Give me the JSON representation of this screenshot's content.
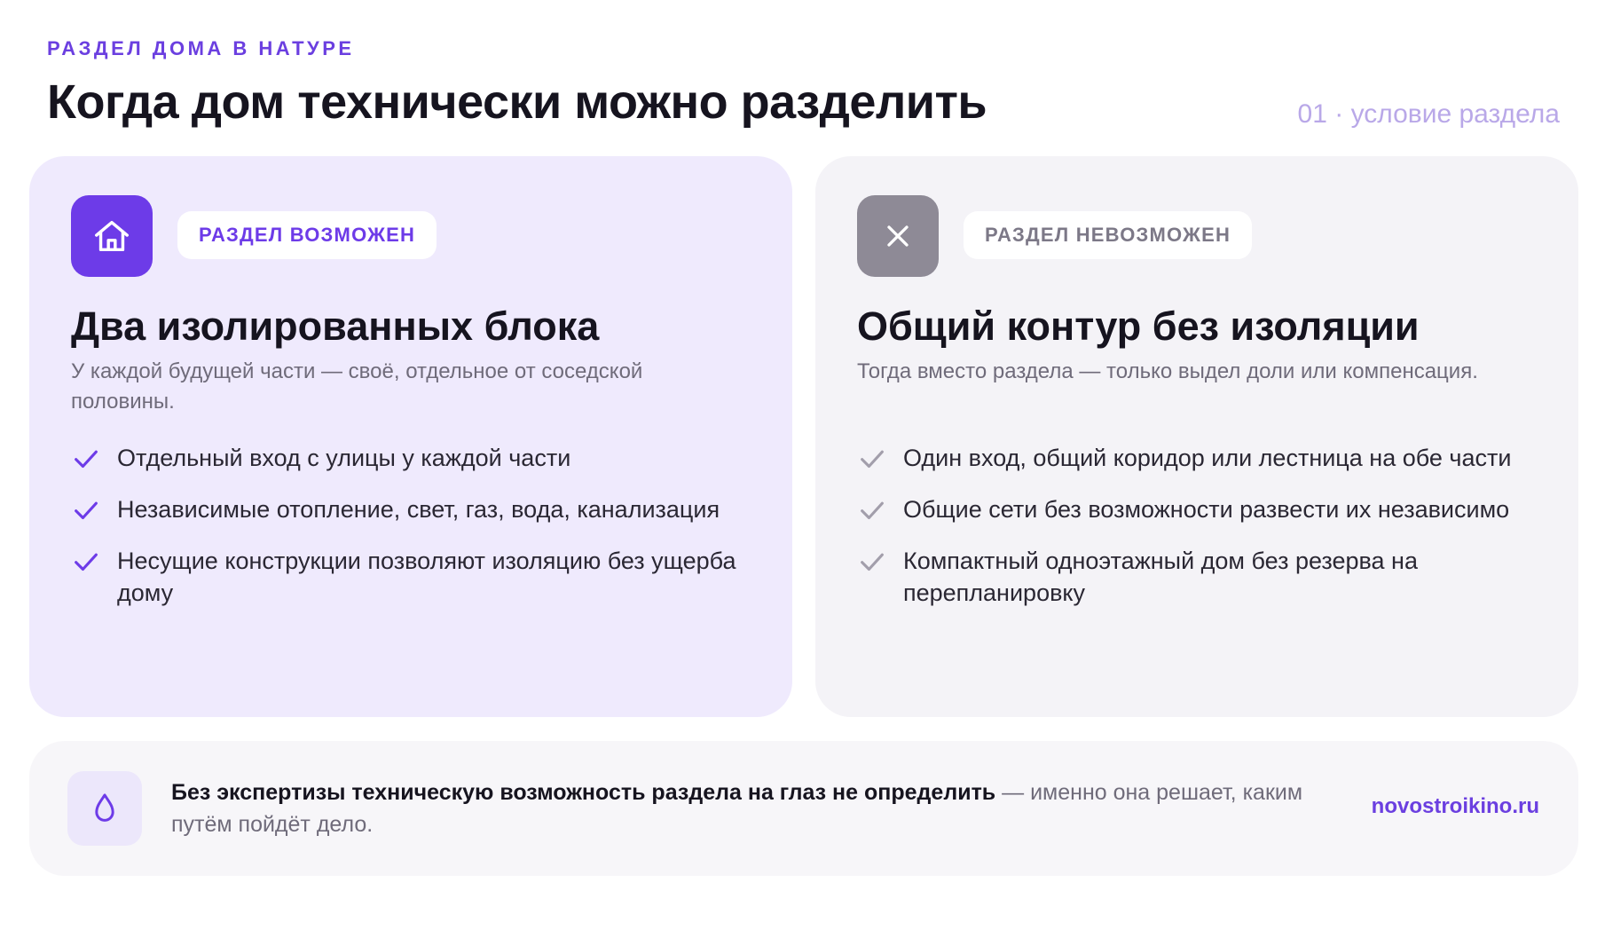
{
  "header": {
    "eyebrow": "РАЗДЕЛ ДОМА В НАТУРЕ",
    "title": "Когда дом технически можно разделить",
    "counter": "01 · условие раздела"
  },
  "cards": [
    {
      "icon": "house-icon",
      "badge": "РАЗДЕЛ ВОЗМОЖЕН",
      "title": "Два изолированных блока",
      "subtitle": "У каждой будущей части — своё, отдельное от соседской половины.",
      "items": [
        "Отдельный вход с улицы у каждой части",
        "Независимые отопление, свет, газ, вода, канализация",
        "Несущие конструкции позволяют изоляцию без ущерба дому"
      ]
    },
    {
      "icon": "close-icon",
      "badge": "РАЗДЕЛ НЕВОЗМОЖЕН",
      "title": "Общий контур без изоляции",
      "subtitle": "Тогда вместо раздела — только выдел доли или компенсация.",
      "items": [
        "Один вход, общий коридор или лестница на обе части",
        "Общие сети без возможности развести их независимо",
        "Компактный одноэтажный дом без резерва на перепланировку"
      ]
    }
  ],
  "footer": {
    "icon": "drop-icon",
    "text_bold": "Без экспертизы техническую возможность раздела на глаз не определить",
    "text_rest": " — именно она решает, каким путём пойдёт дело.",
    "site": "novostroikino.ru"
  },
  "colors": {
    "accent": "#6d3be8",
    "muted": "#8e8a96",
    "card_possible_bg": "#efeafd",
    "card_impossible_bg": "#f4f3f7"
  }
}
